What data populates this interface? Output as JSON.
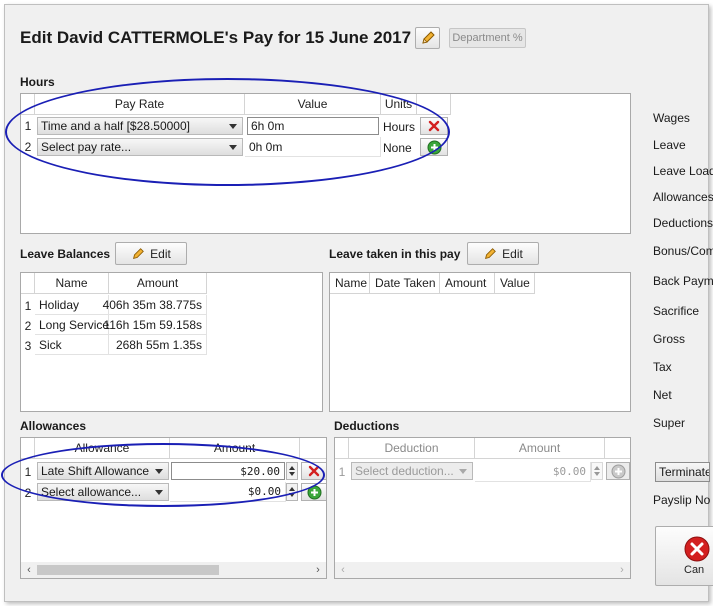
{
  "header": {
    "title": "Edit David CATTERMOLE's Pay for 15 June 2017",
    "department_button": "Department %"
  },
  "hours": {
    "label": "Hours",
    "columns": [
      "Pay Rate",
      "Value",
      "Units"
    ],
    "rows": [
      {
        "num": "1",
        "pay_rate": "Time and a half [$28.50000]",
        "value": "6h 0m",
        "units": "Hours"
      },
      {
        "num": "2",
        "pay_rate": "Select pay rate...",
        "value": "0h 0m",
        "units": "None"
      }
    ]
  },
  "leave_balances": {
    "label": "Leave Balances",
    "edit_label": "Edit",
    "columns": [
      "Name",
      "Amount"
    ],
    "rows": [
      {
        "num": "1",
        "name": "Holiday",
        "amount": "406h 35m 38.775s"
      },
      {
        "num": "2",
        "name": "Long Service",
        "amount": "116h 15m 59.158s"
      },
      {
        "num": "3",
        "name": "Sick",
        "amount": "268h 55m 1.35s"
      }
    ]
  },
  "leave_taken": {
    "label": "Leave taken in this pay",
    "edit_label": "Edit",
    "columns": [
      "Name",
      "Date Taken",
      "Amount",
      "Value"
    ]
  },
  "allowances": {
    "label": "Allowances",
    "columns": [
      "Allowance",
      "Amount"
    ],
    "rows": [
      {
        "num": "1",
        "allowance": "Late Shift Allowance",
        "amount": "$20.00"
      },
      {
        "num": "2",
        "allowance": "Select allowance...",
        "amount": "$0.00"
      }
    ]
  },
  "deductions": {
    "label": "Deductions",
    "columns": [
      "Deduction",
      "Amount"
    ],
    "rows": [
      {
        "num": "1",
        "deduction": "Select deduction...",
        "amount": "$0.00"
      }
    ]
  },
  "summary": {
    "items": [
      "Wages",
      "Leave",
      "Leave Load",
      "Allowances",
      "Deductions",
      "Bonus/Com",
      "Back Paym",
      "Sacrifice",
      "Gross",
      "Tax",
      "Net",
      "Super"
    ],
    "terminate_label": "Terminate",
    "payslip_label": "Payslip No",
    "cancel_label": "Can"
  },
  "colors": {
    "annotation_oval": "#1a1fb5",
    "delete_red": "#d32020",
    "add_green": "#3aa63a"
  },
  "icons": [
    "pencil-icon",
    "delete-x-icon",
    "add-plus-icon",
    "cancel-icon",
    "dropdown-arrow-icon"
  ]
}
